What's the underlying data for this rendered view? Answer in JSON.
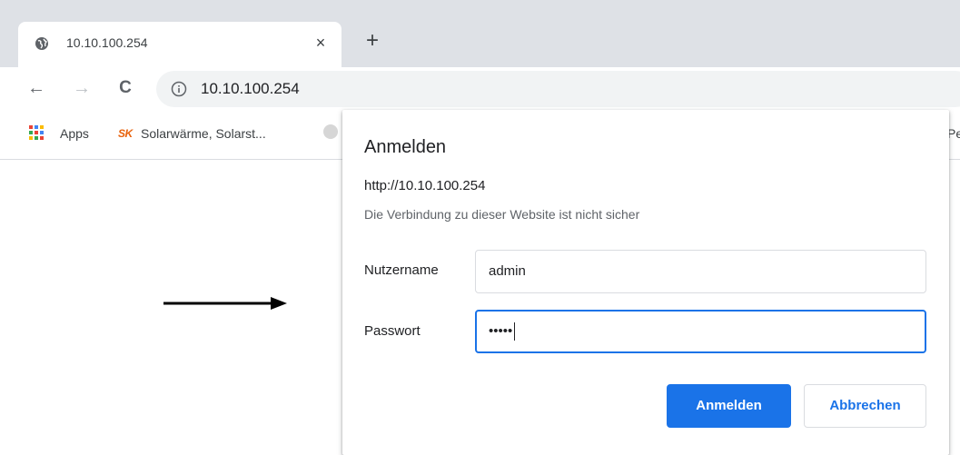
{
  "browser": {
    "tab": {
      "title": "10.10.100.254",
      "close_glyph": "×",
      "icon": "globe-icon"
    },
    "new_tab_glyph": "+",
    "nav": {
      "back_glyph": "←",
      "forward_glyph": "→",
      "reload_glyph": "C"
    },
    "omnibox": {
      "url": "10.10.100.254",
      "icon": "info-icon"
    },
    "bookmarks": [
      {
        "label": "Apps",
        "icon": "apps-grid-icon"
      },
      {
        "label": "Solarwärme, Solarst...",
        "icon": "sk-logo-icon",
        "logo_text": "SK"
      },
      {
        "label": "",
        "icon": "bookmark-favicon"
      }
    ],
    "bookmark_overflow_text": "Pe"
  },
  "auth_dialog": {
    "title": "Anmelden",
    "origin": "http://10.10.100.254",
    "warning": "Die Verbindung zu dieser Website ist nicht sicher",
    "username_label": "Nutzername",
    "username_value": "admin",
    "password_label": "Passwort",
    "password_masked": "•••••",
    "submit_label": "Anmelden",
    "cancel_label": "Abbrechen"
  },
  "colors": {
    "accent": "#1a73e8",
    "tabstrip_bg": "#dee1e6",
    "omnibox_bg": "#f1f3f4",
    "sk_logo": "#e8620c"
  }
}
